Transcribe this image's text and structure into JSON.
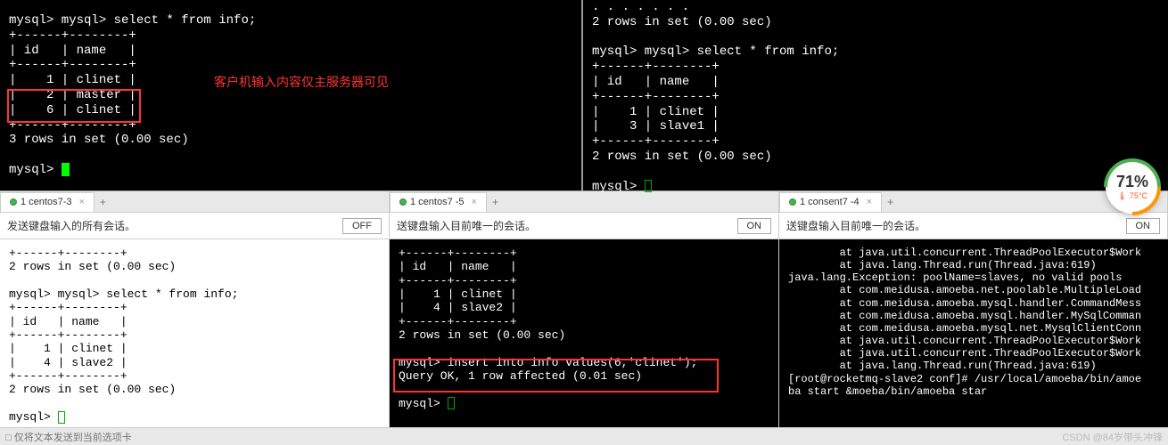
{
  "top_left": {
    "line1": "mysql> mysql> select * from info;",
    "border": "+------+--------+",
    "header": "| id   | name   |",
    "row1": "|    1 | clinet |",
    "row2": "|    2 | master |",
    "row3": "|    6 | clinet |",
    "result": "3 rows in set (0.00 sec)",
    "prompt": "mysql> ",
    "annotation": "客户机输入内容仅主服务器可见"
  },
  "top_right": {
    "dots": ". . . . . . .",
    "result0": "2 rows in set (0.00 sec)",
    "line1": "mysql> mysql> select * from info;",
    "border": "+------+--------+",
    "header": "| id   | name   |",
    "row1": "|    1 | clinet |",
    "row2": "|    3 | slave1 |",
    "result": "2 rows in set (0.00 sec)",
    "prompt": "mysql> "
  },
  "tabs": {
    "t1": "1 centos7-3",
    "t2": "1 centos7 -5",
    "t3": "1 consent7 -4"
  },
  "info": {
    "s1": "发送键盘输入的所有会话。",
    "s2": "送键盘输入目前唯一的会话。",
    "s3": "送键盘输入目前唯一的会话。",
    "btn_off": "OFF",
    "btn_on": "ON"
  },
  "term1": {
    "border": "+------+--------+",
    "result0": "2 rows in set (0.00 sec)",
    "line1": "mysql> mysql> select * from info;",
    "header": "| id   | name   |",
    "row1": "|    1 | clinet |",
    "row2": "|    4 | slave2 |",
    "result": "2 rows in set (0.00 sec)",
    "prompt": "mysql> "
  },
  "term2": {
    "border": "+------+--------+",
    "header": "| id   | name   |",
    "row1": "|    1 | clinet |",
    "row2": "|    4 | slave2 |",
    "result": "2 rows in set (0.00 sec)",
    "insert": "mysql> insert into info values(6,'clinet');",
    "ok": "Query OK, 1 row affected (0.01 sec)",
    "prompt": "mysql> "
  },
  "term3": {
    "l1": "        at java.util.concurrent.ThreadPoolExecutor$Work",
    "l2": "        at java.lang.Thread.run(Thread.java:619)",
    "l3": "java.lang.Exception: poolName=slaves, no valid pools",
    "l4": "        at com.meidusa.amoeba.net.poolable.MultipleLoad",
    "l5": "        at com.meidusa.amoeba.mysql.handler.CommandMess",
    "l6": "        at com.meidusa.amoeba.mysql.handler.MySqlComman",
    "l7": "        at com.meidusa.amoeba.mysql.net.MysqlClientConn",
    "l8": "        at java.util.concurrent.ThreadPoolExecutor$Work",
    "l9": "        at java.util.concurrent.ThreadPoolExecutor$Work",
    "l10": "        at java.lang.Thread.run(Thread.java:619)",
    "l11": "[root@rocketmq-slave2 conf]# /usr/local/amoeba/bin/amoe",
    "l12": "ba start &moeba/bin/amoeba star"
  },
  "badge": {
    "pct": "71%",
    "temp": "🌡 75°C"
  },
  "status": {
    "left": "□ 仅将文本发送到当前选项卡",
    "right": "CSDN @84岁带头冲锋"
  }
}
